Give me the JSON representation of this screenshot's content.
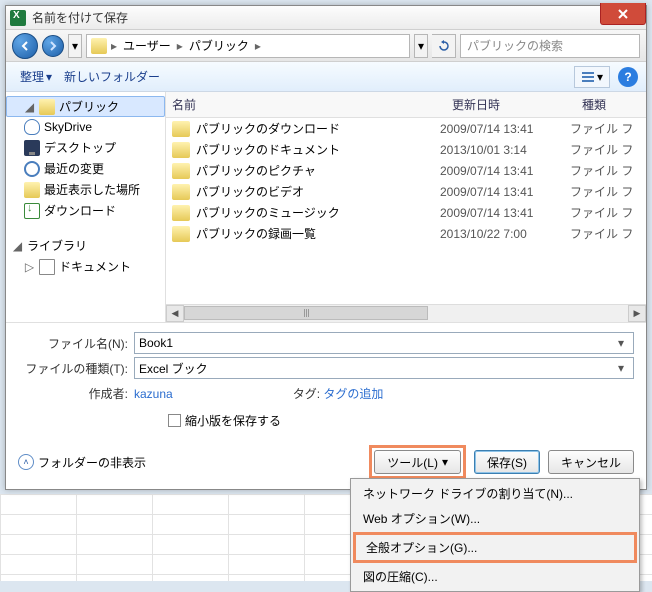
{
  "title": "名前を付けて保存",
  "breadcrumb": {
    "seg1": "ユーザー",
    "seg2": "パブリック"
  },
  "search_placeholder": "パブリックの検索",
  "toolbar": {
    "organize": "整理",
    "new_folder": "新しいフォルダー"
  },
  "nav": {
    "public": "パブリック",
    "skydrive": "SkyDrive",
    "desktop": "デスクトップ",
    "recent": "最近の変更",
    "recent_places": "最近表示した場所",
    "downloads": "ダウンロード",
    "library": "ライブラリ",
    "documents": "ドキュメント"
  },
  "columns": {
    "name": "名前",
    "date": "更新日時",
    "type": "種類"
  },
  "files": [
    {
      "name": "パブリックのダウンロード",
      "date": "2009/07/14 13:41",
      "type": "ファイル フ"
    },
    {
      "name": "パブリックのドキュメント",
      "date": "2013/10/01 3:14",
      "type": "ファイル フ"
    },
    {
      "name": "パブリックのピクチャ",
      "date": "2009/07/14 13:41",
      "type": "ファイル フ"
    },
    {
      "name": "パブリックのビデオ",
      "date": "2009/07/14 13:41",
      "type": "ファイル フ"
    },
    {
      "name": "パブリックのミュージック",
      "date": "2009/07/14 13:41",
      "type": "ファイル フ"
    },
    {
      "name": "パブリックの録画一覧",
      "date": "2013/10/22 7:00",
      "type": "ファイル フ"
    }
  ],
  "form": {
    "filename_label": "ファイル名(N):",
    "filename_value": "Book1",
    "filetype_label": "ファイルの種類(T):",
    "filetype_value": "Excel ブック",
    "author_label": "作成者:",
    "author_value": "kazuna",
    "tag_label": "タグ:",
    "tag_value": "タグの追加",
    "thumbnail": "縮小版を保存する"
  },
  "footer": {
    "hide_folders": "フォルダーの非表示",
    "tools": "ツール(L)",
    "save": "保存(S)",
    "cancel": "キャンセル"
  },
  "menu": {
    "map_drive": "ネットワーク ドライブの割り当て(N)...",
    "web_options": "Web オプション(W)...",
    "general_options": "全般オプション(G)...",
    "compress": "図の圧縮(C)..."
  }
}
